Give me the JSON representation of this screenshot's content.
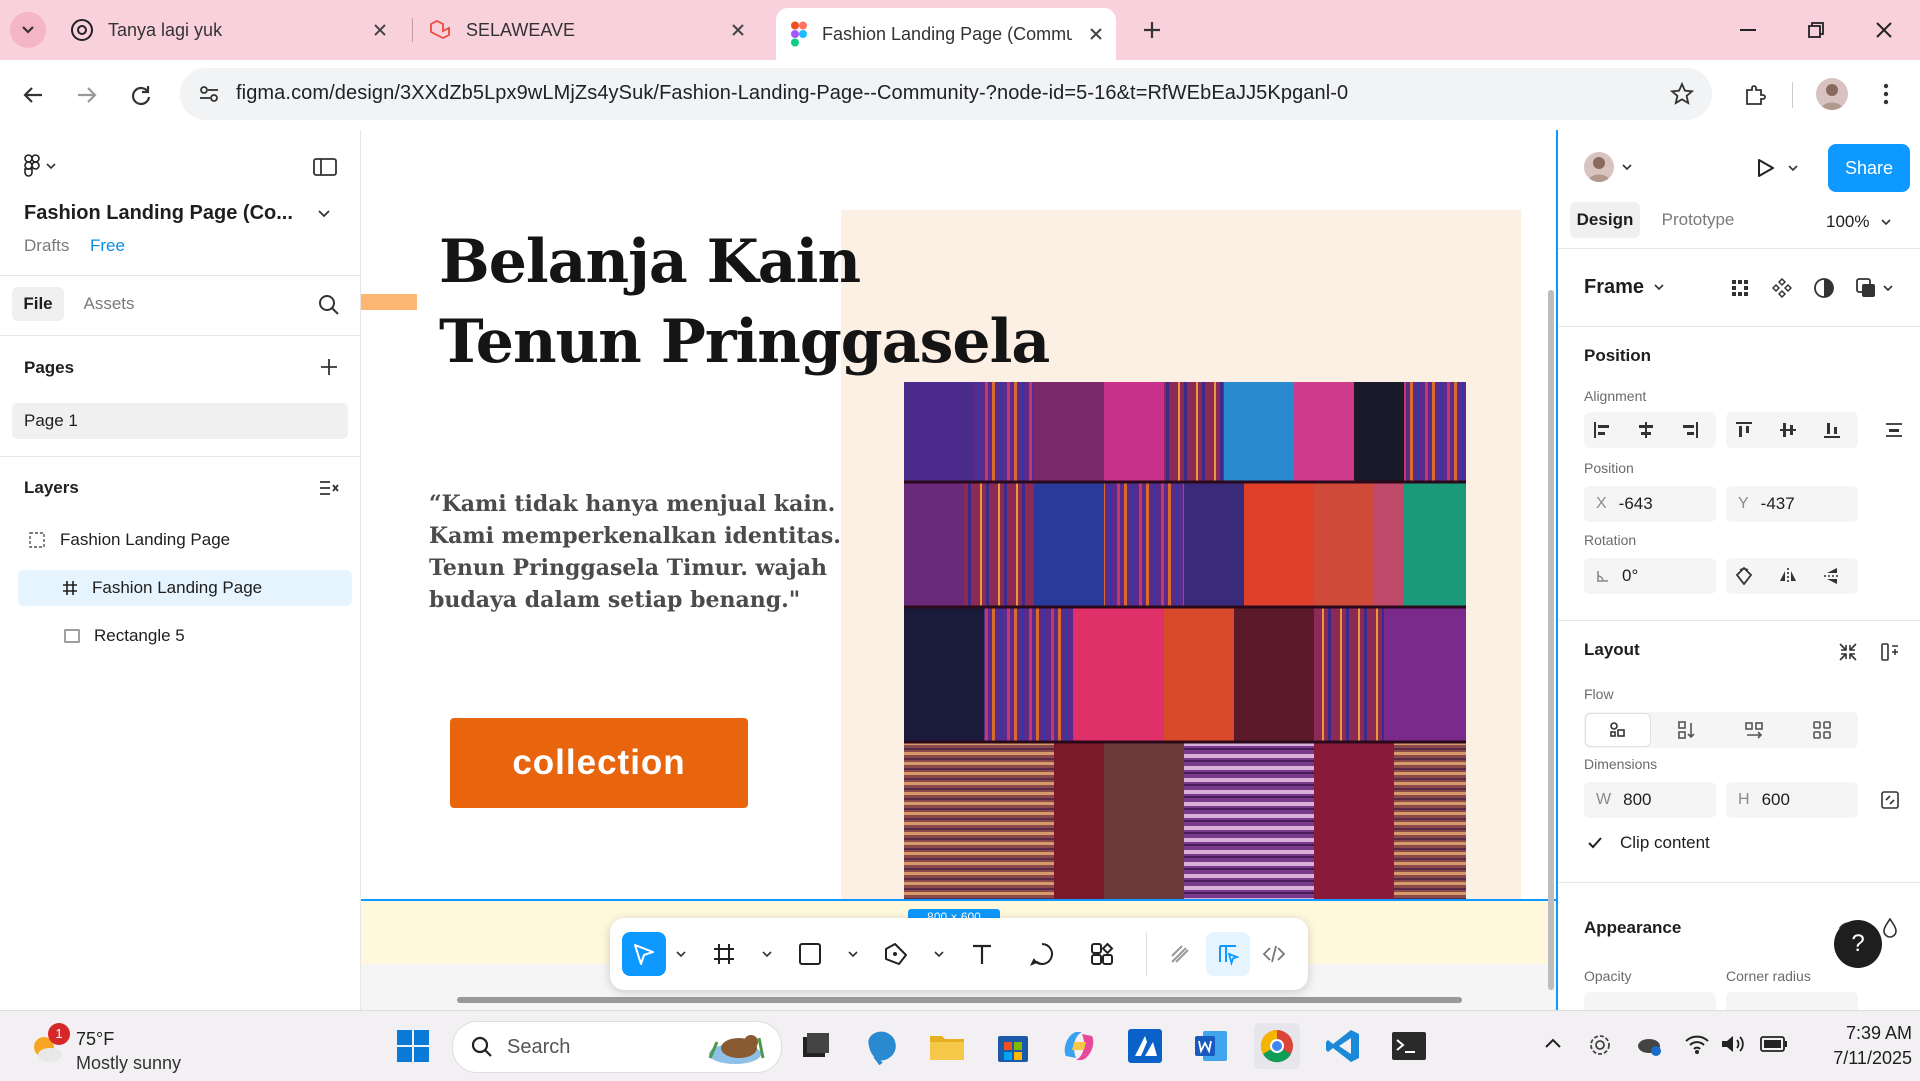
{
  "browser": {
    "tabs": [
      {
        "title": "Tanya lagi yuk",
        "icon": "chatgpt-icon"
      },
      {
        "title": "SELAWEAVE",
        "icon": "laravel-icon"
      },
      {
        "title": "Fashion Landing Page (Commun",
        "icon": "figma-icon",
        "active": true
      }
    ],
    "new_tab_label": "+",
    "url": "figma.com/design/3XXdZb5Lpx9wLMjZs4ySuk/Fashion-Landing-Page--Community-?node-id=5-16&t=RfWEbEaJJ5Kpganl-0"
  },
  "left_panel": {
    "file_name": "Fashion Landing Page (Co...",
    "location": "Drafts",
    "plan_badge": "Free",
    "tabs": [
      "File",
      "Assets"
    ],
    "pages_heading": "Pages",
    "pages": [
      "Page 1"
    ],
    "layers_heading": "Layers",
    "layers": [
      {
        "name": "Fashion Landing Page",
        "icon": "section-icon",
        "indent": 0
      },
      {
        "name": "Fashion Landing Page",
        "icon": "frame-hash-icon",
        "indent": 1,
        "selected": true
      },
      {
        "name": "Rectangle 5",
        "icon": "rectangle-icon",
        "indent": 1
      }
    ]
  },
  "canvas": {
    "headline_line1": "Belanja Kain",
    "headline_line2": "Tenun Pringgasela",
    "quote": "“Kami tidak hanya menjual kain. Kami memperkenalkan identitas. Tenun Pringgasela Timur. wajah budaya dalam setiap benang.\"",
    "cta_label": "collection",
    "size_badge": "800 × 600"
  },
  "right_panel": {
    "tabs": [
      "Design",
      "Prototype"
    ],
    "zoom": "100%",
    "share_label": "Share",
    "frame_label": "Frame",
    "position_heading": "Position",
    "alignment_label": "Alignment",
    "position_label": "Position",
    "x_prefix": "X",
    "x_value": "-643",
    "y_prefix": "Y",
    "y_value": "-437",
    "rotation_label": "Rotation",
    "rotation_value": "0°",
    "layout_heading": "Layout",
    "flow_label": "Flow",
    "dimensions_label": "Dimensions",
    "w_prefix": "W",
    "w_value": "800",
    "h_prefix": "H",
    "h_value": "600",
    "clip_content_label": "Clip content",
    "clip_content_checked": true,
    "appearance_heading": "Appearance",
    "opacity_label": "Opacity",
    "corner_radius_label": "Corner radius"
  },
  "taskbar": {
    "weather_temp": "75°F",
    "weather_desc": "Mostly sunny",
    "weather_badge": "1",
    "search_placeholder": "Search",
    "time": "7:39 AM",
    "date": "7/11/2025"
  },
  "colors": {
    "tabbar_bg": "#f9d1dc",
    "figma_blue": "#0d99ff",
    "cta_orange": "#e8650d",
    "peach_bg": "#fcefe4"
  }
}
